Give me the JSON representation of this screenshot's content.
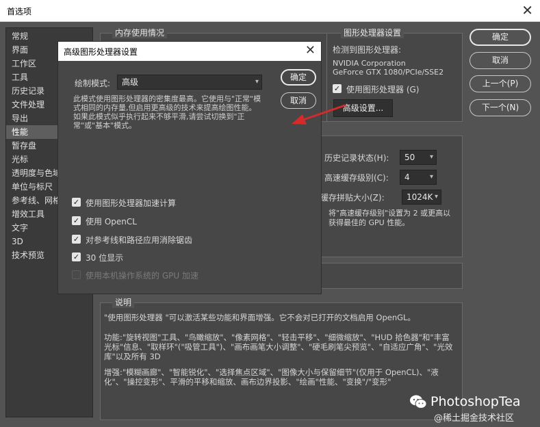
{
  "window": {
    "title": "首选项"
  },
  "sidebar": {
    "items": [
      "常规",
      "界面",
      "工作区",
      "工具",
      "历史记录",
      "文件处理",
      "导出",
      "性能",
      "暂存盘",
      "光标",
      "透明度与色域",
      "单位与标尺",
      "参考线、网格和切片",
      "增效工具",
      "文字",
      "3D",
      "技术预览"
    ],
    "selected": "性能"
  },
  "memory": {
    "title": "内存使用情况"
  },
  "gpu": {
    "title": "图形处理器设置",
    "detected_label": "检测到图形处理器:",
    "vendor": "NVIDIA Corporation",
    "model": "GeForce GTX 1080/PCIe/SSE2",
    "use_gpu_label": "使用图形处理器 (G)",
    "advanced_button": "高级设置..."
  },
  "right_buttons": {
    "ok": "确定",
    "cancel": "取消",
    "prev": "上一个(P)",
    "next": "下一个(N)"
  },
  "history_cache": {
    "history_label": "历史记录状态(H):",
    "history_value": "50",
    "cache_levels_label": "高速缓存级别(C):",
    "cache_levels_value": "4",
    "tile_size_label": "缓存拼贴大小(Z):",
    "tile_size_value": "1024K",
    "hint": "将\"高速缓存级别\"设置为 2 或更高以获得最佳的 GPU 性能。"
  },
  "description": {
    "title": "说明",
    "p1": "\"使用图形处理器 \"可以激活某些功能和界面增强。它不会对已打开的文档启用 OpenGL。",
    "p2": "功能:\"旋转视图\"工具、\"鸟瞰缩放\"、\"像素网格\"、\"轻击平移\"、\"细微缩放\"、\"HUD 拾色器\"和\"丰富光标\"信息、\"取样环\"(\"吸管工具\")、\"画布画笔大小调整\"、\"硬毛刷笔尖预览\"、\"自适应广角\"、\"光效库\"以及所有 3D",
    "p3": "增强:\"模糊画廊\"、\"智能锐化\"、\"选择焦点区域\"、\"图像大小与保留细节\"(仅用于 OpenCL)、\"液化\"、\"操控变形\"、平滑的平移和缩放、画布边界投影、\"绘画\"性能、\"变换\"/\"变形\""
  },
  "dialog": {
    "title": "高级图形处理器设置",
    "draw_mode_label": "绘制模式:",
    "draw_mode_value": "高级",
    "ok": "确定",
    "cancel": "取消",
    "description": "此模式使用图形处理器的密集度最高。它使用与\"正常\"模式相同的内存量,但启用更高级的技术来提高绘图性能。如果此模式似乎执行起来不够平滑,请尝试切换到\"正常\"或\"基本\"模式。",
    "options": [
      {
        "label": "使用图形处理器加速计算",
        "checked": true,
        "enabled": true
      },
      {
        "label": "使用 OpenCL",
        "checked": true,
        "enabled": true
      },
      {
        "label": "对参考线和路径应用消除锯齿",
        "checked": true,
        "enabled": true
      },
      {
        "label": "30 位显示",
        "checked": true,
        "enabled": true
      },
      {
        "label": "使用本机操作系统的 GPU 加速",
        "checked": false,
        "enabled": false
      }
    ]
  },
  "watermark": {
    "brand": "PhotoshopTea",
    "site": "@稀土掘金技术社区"
  },
  "colors": {
    "arrow": "#d42a2a",
    "background": "#535353",
    "dialog": "#474747"
  }
}
